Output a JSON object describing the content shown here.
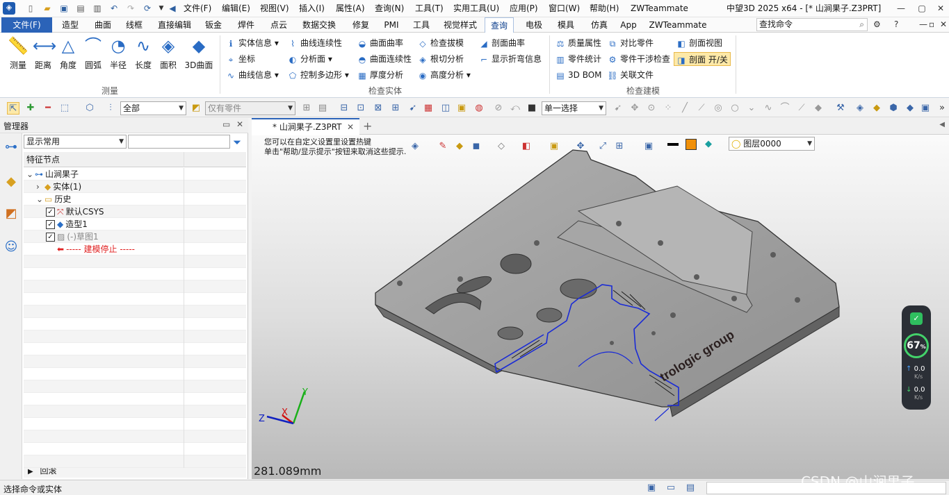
{
  "title": {
    "app_title": "中望3D 2025 x64 - [* 山涧果子.Z3PRT]",
    "menus": [
      "文件(F)",
      "编辑(E)",
      "视图(V)",
      "插入(I)",
      "属性(A)",
      "查询(N)",
      "工具(T)",
      "实用工具(U)",
      "应用(P)",
      "窗口(W)",
      "帮助(H)",
      "ZWTeammate"
    ]
  },
  "ribbon_tabs": [
    "文件(F)",
    "造型",
    "曲面",
    "线框",
    "直接编辑",
    "钣金",
    "焊件",
    "点云",
    "数据交换",
    "修复",
    "PMI",
    "工具",
    "视觉样式",
    "查询",
    "电极",
    "模具",
    "仿真",
    "App",
    "ZWTeammate"
  ],
  "search": {
    "placeholder": "查找命令"
  },
  "ribbon": {
    "measure_buttons": [
      "测量",
      "距离",
      "角度",
      "圆弧",
      "半径",
      "长度",
      "面积",
      "3D曲面"
    ],
    "measure_group": "测量",
    "col1": [
      "实体信息",
      "坐标",
      "曲线信息"
    ],
    "col2": [
      "曲线连续性",
      "分析面",
      "控制多边形"
    ],
    "col3": [
      "曲面曲率",
      "曲面连续性",
      "厚度分析"
    ],
    "col4": [
      "检查拔模",
      "根切分析",
      "高度分析"
    ],
    "col5": [
      "剖面曲率",
      "显示折弯信息"
    ],
    "inspect_solid_group": "检查实体",
    "col6": [
      "质量属性",
      "零件统计",
      "3D BOM"
    ],
    "col7": [
      "对比零件",
      "零件干涉检查",
      "关联文件"
    ],
    "col8": [
      "剖面视图",
      "剖面 开/关"
    ],
    "inspect_model_group": "检查建模"
  },
  "toolbar2": {
    "filter": "全部",
    "scope": "仅有零件",
    "select_mode": "单一选择"
  },
  "manager": {
    "title": "管理器",
    "filter": "显示常用",
    "column_header": "特征节点",
    "tree": [
      {
        "label": "山涧果子",
        "indent": 0
      },
      {
        "label": "实体(1)",
        "indent": 1
      },
      {
        "label": "历史",
        "indent": 1
      },
      {
        "label": "默认CSYS",
        "indent": 2
      },
      {
        "label": "造型1",
        "indent": 2
      },
      {
        "label": "(-)草图1",
        "indent": 2
      },
      {
        "label": "----- 建模停止 -----",
        "indent": 2
      }
    ],
    "footer": "回滚"
  },
  "viewport": {
    "doc_tab": "* 山涧果子.Z3PRT",
    "hint_line1": "您可以在自定义设置里设置热键",
    "hint_line2": "单击\"帮助/显示提示\"按钮来取消这些提示.",
    "layer": "图层0000",
    "dimension": "281.089mm",
    "engraving": "trologic group",
    "axis_x": "X",
    "axis_y": "Y",
    "axis_z": "Z"
  },
  "monitor": {
    "percent": "67",
    "unit": "%",
    "up": "0.0",
    "up_unit": "K/s",
    "down": "0.0",
    "down_unit": "K/s"
  },
  "status": {
    "prompt": "选择命令或实体",
    "watermark": "CSDN @山涧果子"
  },
  "colors": {
    "file_tab": "#2b63b8",
    "accent": "#2a6cc4",
    "sketch_blue": "#1a2bd6",
    "part_gray": "#9c9c9c"
  }
}
